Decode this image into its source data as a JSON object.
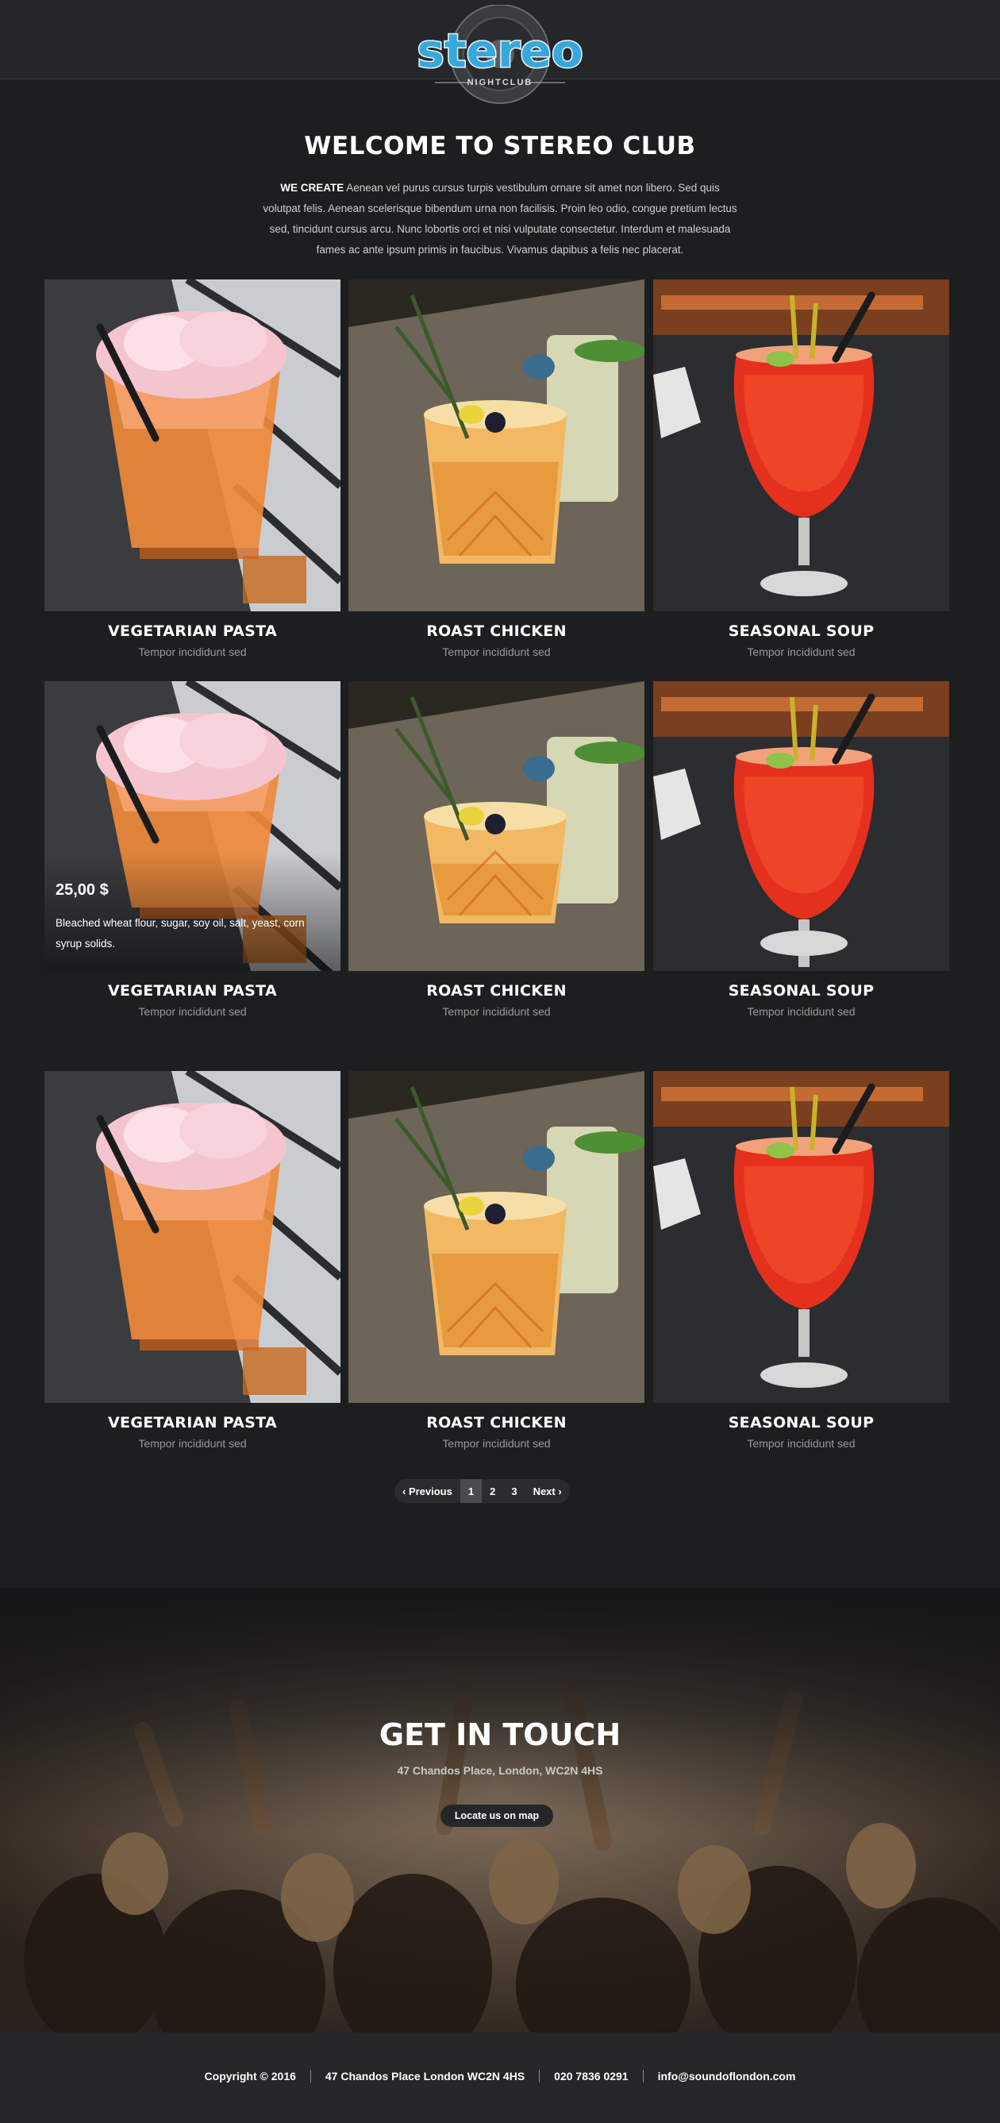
{
  "brand": {
    "logo_word": "stereo",
    "logo_sub": "NIGHTCLUB"
  },
  "intro": {
    "title": "WELCOME TO STEREO CLUB",
    "lead": "WE CREATE",
    "body": "Aenean vel purus cursus turpis vestibulum ornare sit amet non libero. Sed quis volutpat felis. Aenean scelerisque bibendum urna non facilisis. Proin leo odio, congue pretium lectus sed, tincidunt cursus arcu. Nunc lobortis orci et nisi vulputate consectetur. Interdum et malesuada fames ac ante ipsum primis in faucibus. Vivamus dapibus a felis nec placerat."
  },
  "rows": [
    {
      "items": [
        {
          "title": "VEGETARIAN PASTA",
          "subtitle": "Tempor incididunt sed",
          "photo": "pink-ice-cocktail"
        },
        {
          "title": "ROAST CHICKEN",
          "subtitle": "Tempor incididunt sed",
          "photo": "herb-whisky-cocktail"
        },
        {
          "title": "SEASONAL SOUP",
          "subtitle": "Tempor incididunt sed",
          "photo": "red-hurricane-cocktail"
        }
      ]
    },
    {
      "items": [
        {
          "title": "VEGETARIAN PASTA",
          "subtitle": "Tempor incididunt sed",
          "photo": "pink-ice-cocktail",
          "price": "25,00 $",
          "ingredients": "Bleached wheat flour, sugar, soy oil, salt, yeast, corn syrup solids."
        },
        {
          "title": "ROAST CHICKEN",
          "subtitle": "Tempor incididunt sed",
          "photo": "herb-whisky-cocktail"
        },
        {
          "title": "SEASONAL SOUP",
          "subtitle": "Tempor incididunt sed",
          "photo": "red-hurricane-cocktail"
        }
      ]
    },
    {
      "items": [
        {
          "title": "VEGETARIAN PASTA",
          "subtitle": "Tempor incididunt sed",
          "photo": "pink-ice-cocktail"
        },
        {
          "title": "ROAST CHICKEN",
          "subtitle": "Tempor incididunt sed",
          "photo": "herb-whisky-cocktail"
        },
        {
          "title": "SEASONAL SOUP",
          "subtitle": "Tempor incididunt sed",
          "photo": "red-hurricane-cocktail"
        }
      ]
    }
  ],
  "pagination": {
    "prev": "‹  Previous",
    "pages": [
      "1",
      "2",
      "3"
    ],
    "current": "1",
    "next": "Next  ›"
  },
  "contact": {
    "title": "GET IN TOUCH",
    "address": "47 Chandos Place, London, WC2N 4HS",
    "map_button": "Locate us on map"
  },
  "footer": {
    "copyright": "Copyright © 2016",
    "address": "47 Chandos Place London WC2N 4HS",
    "phone": "020 7836 0291",
    "email": "info@soundoflondon.com"
  },
  "colors": {
    "background": "#1d1e20",
    "header": "#252628",
    "logo_blue": "#37a8dc"
  }
}
